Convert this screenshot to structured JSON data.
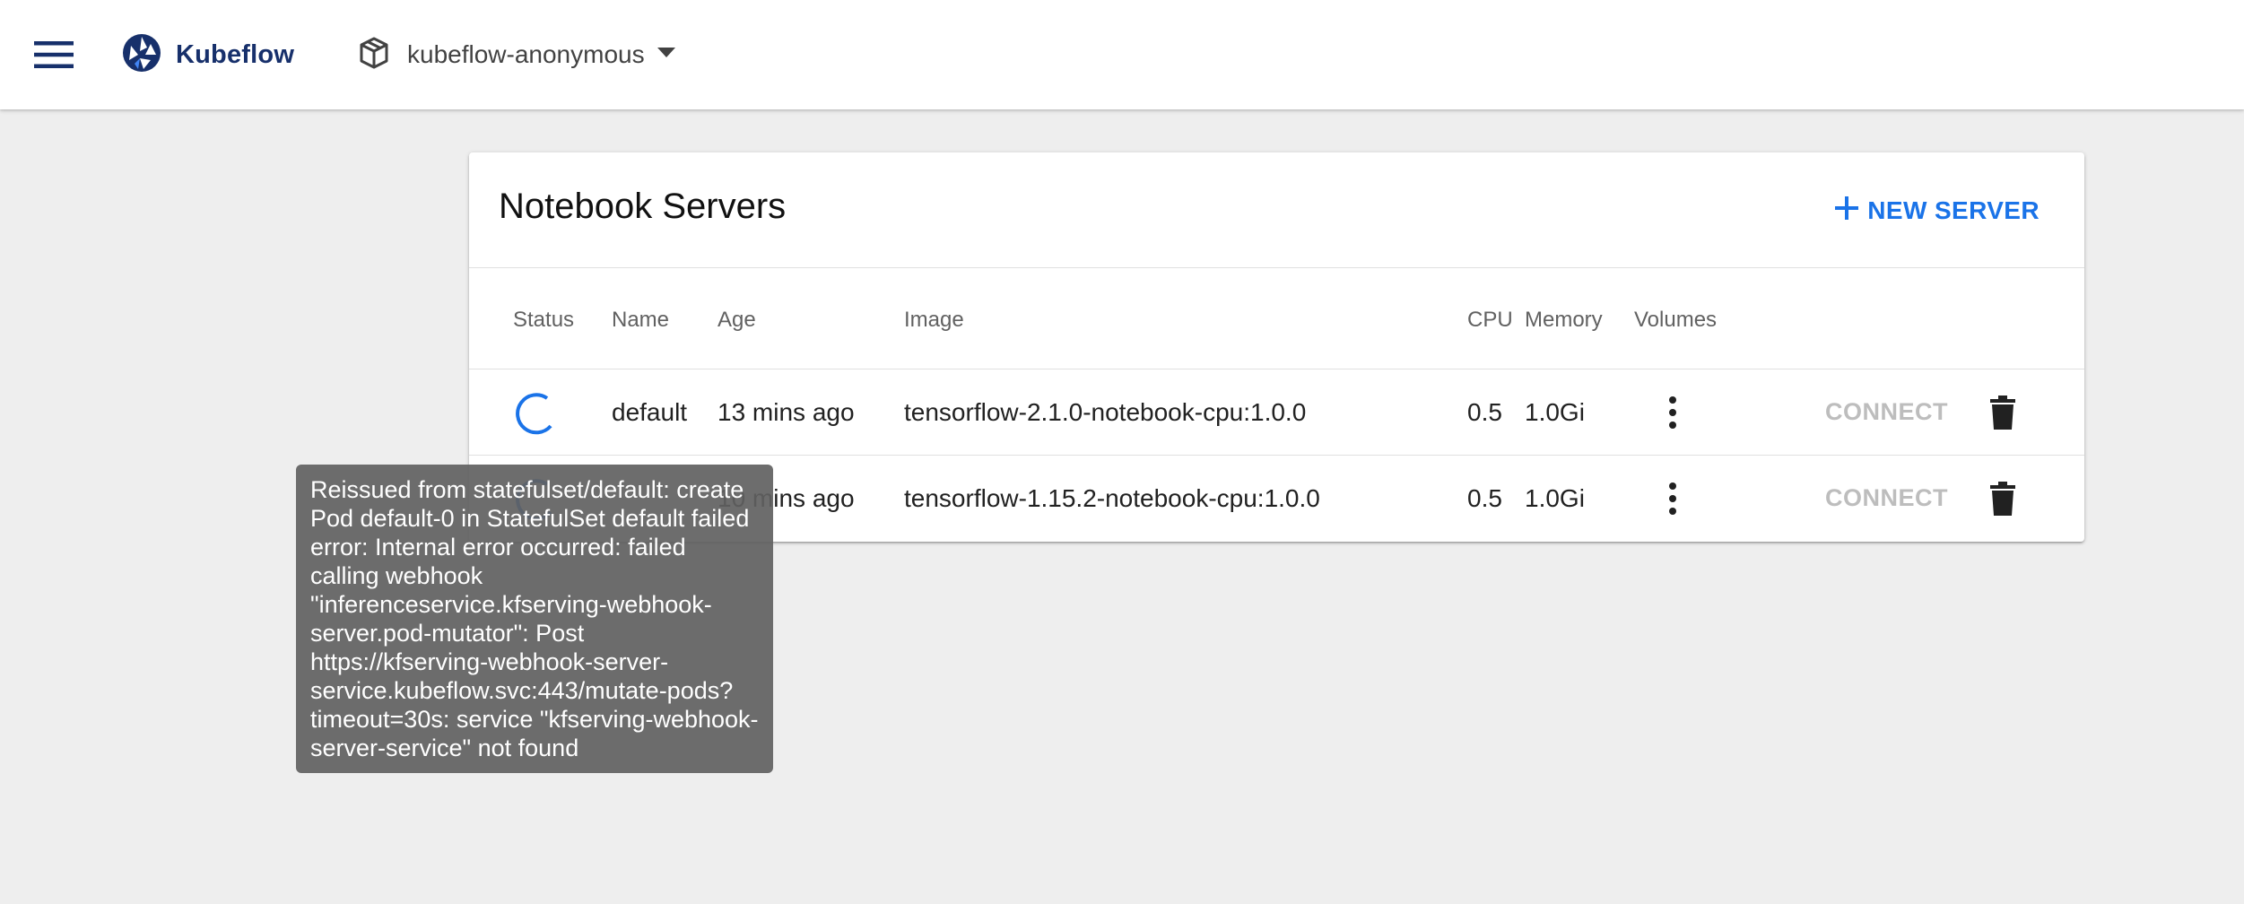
{
  "topbar": {
    "menu_icon": "hamburger-menu-icon",
    "logo_icon": "kubeflow-logo-icon",
    "logo_text": "Kubeflow",
    "namespace_icon": "cube-icon",
    "namespace": "kubeflow-anonymous",
    "namespace_caret_icon": "caret-down-icon"
  },
  "card": {
    "title": "Notebook Servers",
    "new_server_icon": "plus-icon",
    "new_server_label": "NEW SERVER"
  },
  "table": {
    "headers": {
      "status": "Status",
      "name": "Name",
      "age": "Age",
      "image": "Image",
      "cpu": "CPU",
      "memory": "Memory",
      "volumes": "Volumes"
    },
    "rows": [
      {
        "status_icon": "loading-spinner-icon",
        "name": "default",
        "age": "13 mins ago",
        "image": "tensorflow-2.1.0-notebook-cpu:1.0.0",
        "cpu": "0.5",
        "memory": "1.0Gi",
        "volumes_icon": "more-vert-icon",
        "connect_label": "CONNECT",
        "delete_icon": "trash-icon"
      },
      {
        "status_icon": "loading-spinner-icon",
        "name": "",
        "age": "10 mins ago",
        "image": "tensorflow-1.15.2-notebook-cpu:1.0.0",
        "cpu": "0.5",
        "memory": "1.0Gi",
        "volumes_icon": "more-vert-icon",
        "connect_label": "CONNECT",
        "delete_icon": "trash-icon"
      }
    ]
  },
  "tooltip": {
    "text": "Reissued from statefulset/default: create Pod default-0 in StatefulSet default failed error: Internal error occurred: failed calling webhook \"inferenceservice.kfserving-webhook-server.pod-mutator\": Post https://kfserving-webhook-server-service.kubeflow.svc:443/mutate-pods?timeout=30s: service \"kfserving-webhook-server-service\" not found"
  },
  "colors": {
    "accent": "#1a73e8",
    "logo": "#17306b",
    "disabled_text": "#bdbdbd",
    "tooltip_bg": "#616161",
    "background": "#eeeeee"
  }
}
